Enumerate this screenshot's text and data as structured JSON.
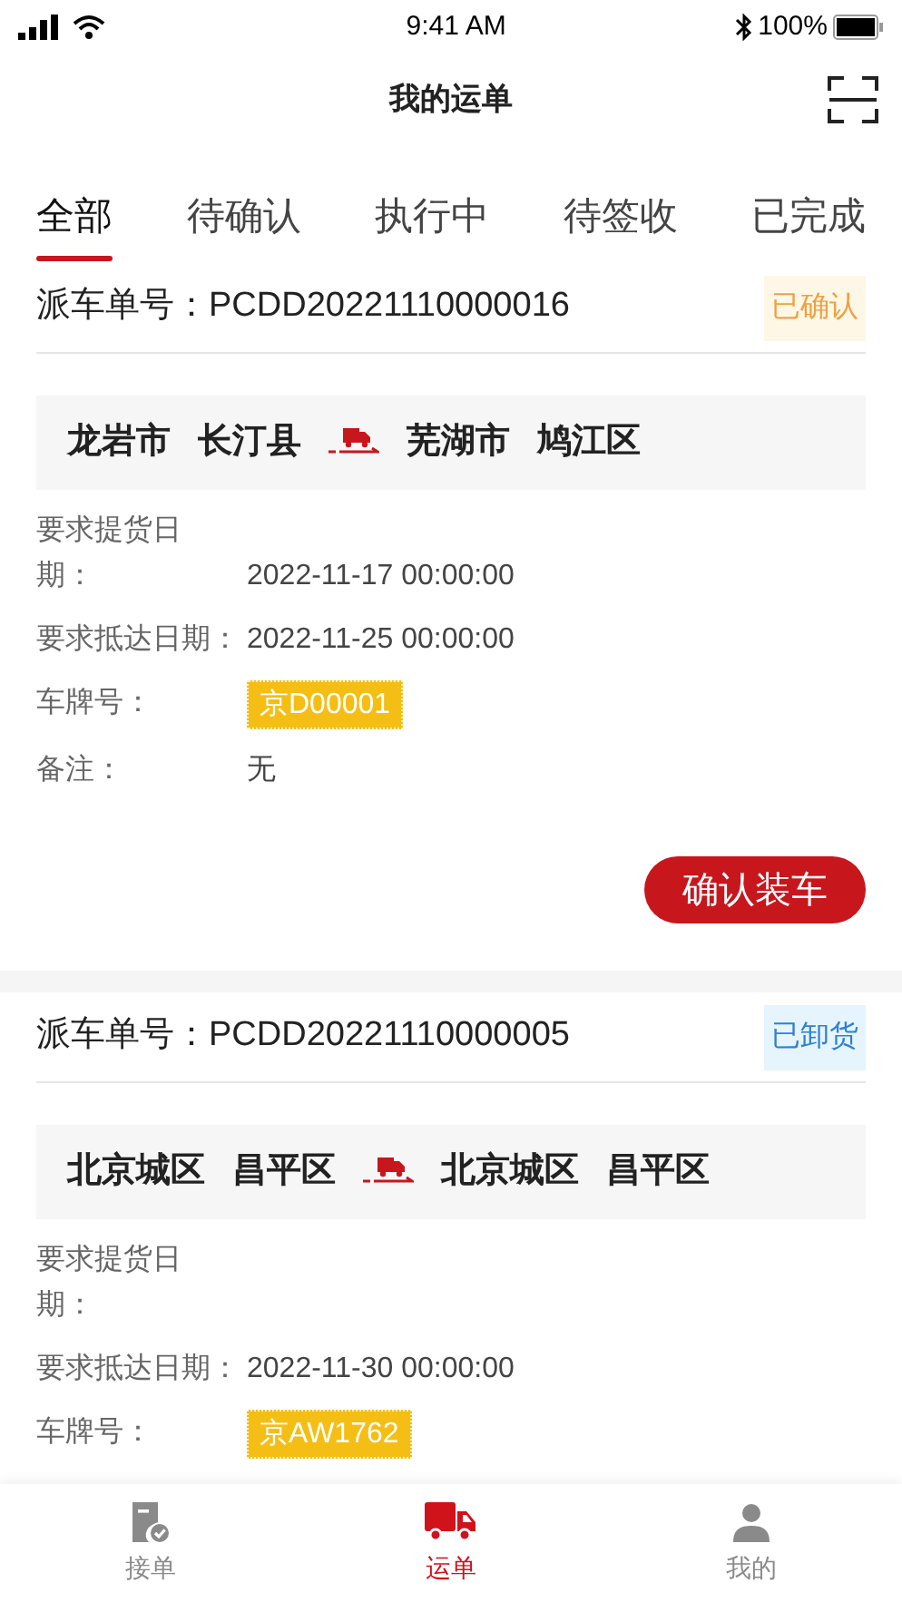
{
  "status_bar": {
    "time": "9:41 AM",
    "battery": "100%"
  },
  "nav": {
    "title": "我的运单"
  },
  "tabs": [
    {
      "label": "全部",
      "selected": true
    },
    {
      "label": "待确认",
      "selected": false
    },
    {
      "label": "执行中",
      "selected": false
    },
    {
      "label": "待签收",
      "selected": false
    },
    {
      "label": "已完成",
      "selected": false
    }
  ],
  "orders": [
    {
      "label": "派车单号：",
      "number": "PCDD20221110000016",
      "status": {
        "text": "已确认",
        "kind": "confirmed"
      },
      "from": [
        "龙岩市",
        "长汀县"
      ],
      "to": [
        "芜湖市",
        "鸠江区"
      ],
      "rows": [
        {
          "kind": "narrow",
          "label": "要求提货日期：",
          "value": "2022-11-17 00:00:00"
        },
        {
          "kind": "inline",
          "label": "要求抵达日期：",
          "value": "2022-11-25 00:00:00"
        },
        {
          "kind": "plate",
          "label": "车牌号：",
          "value": "京D00001"
        },
        {
          "kind": "inline",
          "label": "备注：",
          "value": "无"
        }
      ],
      "action": "确认装车"
    },
    {
      "label": "派车单号：",
      "number": "PCDD20221110000005",
      "status": {
        "text": "已卸货",
        "kind": "unloaded"
      },
      "from": [
        "北京城区",
        "昌平区"
      ],
      "to": [
        "北京城区",
        "昌平区"
      ],
      "rows": [
        {
          "kind": "narrow",
          "label": "要求提货日期："
        },
        {
          "kind": "inline",
          "label": "要求抵达日期：",
          "value": "2022-11-30 00:00:00"
        },
        {
          "kind": "plate",
          "label": "车牌号：",
          "value": "京AW1762"
        }
      ]
    }
  ],
  "bottom_tabs": [
    {
      "label": "接单",
      "kind": "doc",
      "selected": false
    },
    {
      "label": "运单",
      "kind": "truck",
      "selected": true
    },
    {
      "label": "我的",
      "kind": "person",
      "selected": false
    }
  ]
}
